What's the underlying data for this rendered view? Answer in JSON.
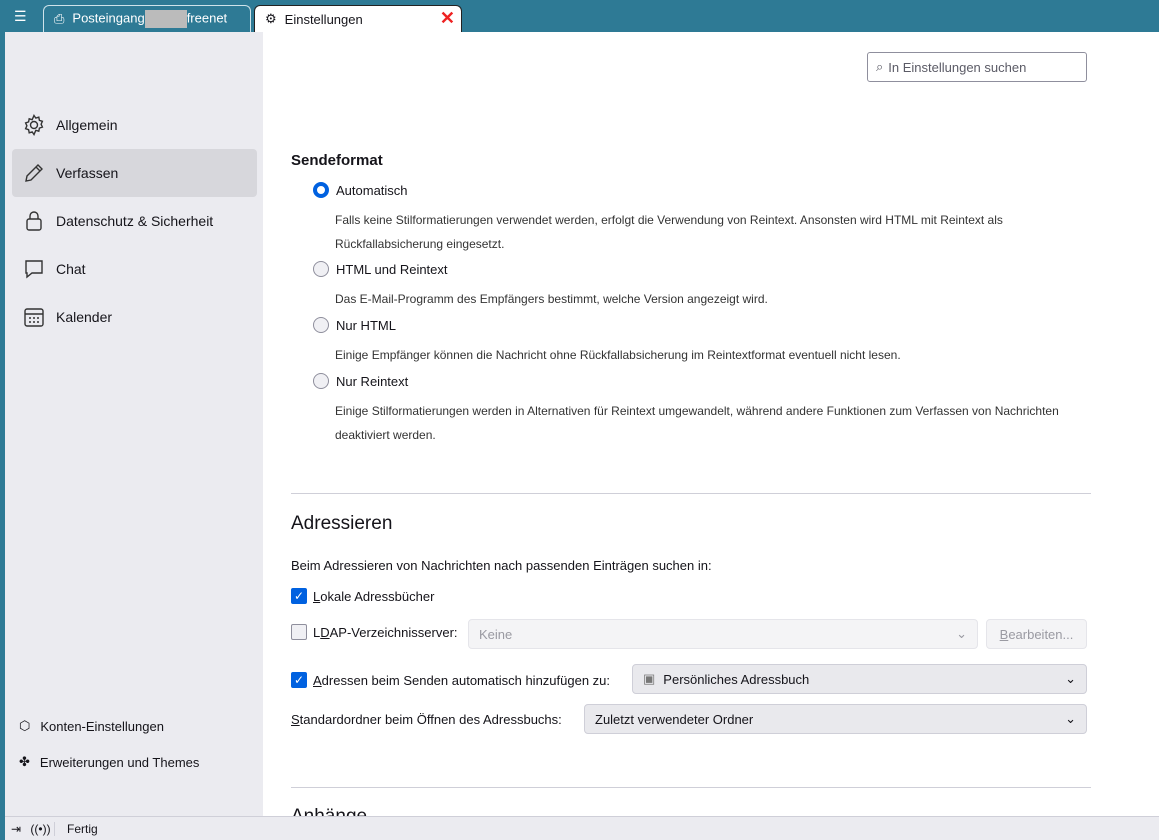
{
  "tabs": [
    {
      "label_prefix": "Posteingang",
      "label_suffix": "freenet"
    },
    {
      "label": "Einstellungen"
    }
  ],
  "search": {
    "placeholder": "In Einstellungen suchen"
  },
  "sidebar": {
    "items": [
      {
        "label": "Allgemein"
      },
      {
        "label": "Verfassen"
      },
      {
        "label": "Datenschutz & Sicherheit"
      },
      {
        "label": "Chat"
      },
      {
        "label": "Kalender"
      }
    ],
    "footer": [
      {
        "label": "Konten-Einstellungen"
      },
      {
        "label": "Erweiterungen und Themes"
      }
    ]
  },
  "sendeformat": {
    "title": "Sendeformat",
    "options": [
      {
        "label": "Automatisch",
        "desc": "Falls keine Stilformatierungen verwendet werden, erfolgt die Verwendung von Reintext. Ansonsten wird HTML mit Reintext als Rückfallabsicherung eingesetzt.",
        "selected": true
      },
      {
        "label": "HTML und Reintext",
        "desc": "Das E-Mail-Programm des Empfängers bestimmt, welche Version angezeigt wird."
      },
      {
        "label": "Nur HTML",
        "desc": "Einige Empfänger können die Nachricht ohne Rückfallabsicherung im Reintextformat eventuell nicht lesen."
      },
      {
        "label": "Nur Reintext",
        "desc": "Einige Stilformatierungen werden in Alternativen für Reintext umgewandelt, während andere Funktionen zum Verfassen von Nachrichten deaktiviert werden."
      }
    ]
  },
  "adressieren": {
    "title": "Adressieren",
    "intro": "Beim Adressieren von Nachrichten nach passenden Einträgen suchen in:",
    "local_ab": {
      "k": "L",
      "rest": "okale Adressbücher",
      "checked": true
    },
    "ldap": {
      "a": "L",
      "k": "D",
      "rest": "AP-Verzeichnisserver:",
      "value": "Keine",
      "edit_k": "B",
      "edit_rest": "earbeiten...",
      "checked": false
    },
    "auto_add": {
      "k": "A",
      "rest": "dressen beim Senden automatisch hinzufügen zu:",
      "value": "Persönliches Adressbuch",
      "checked": true
    },
    "default_folder": {
      "k": "S",
      "rest": "tandardordner beim Öffnen des Adressbuchs:",
      "value": "Zuletzt verwendeter Ordner"
    }
  },
  "next_section": "Anhänge",
  "status": {
    "text": "Fertig"
  }
}
